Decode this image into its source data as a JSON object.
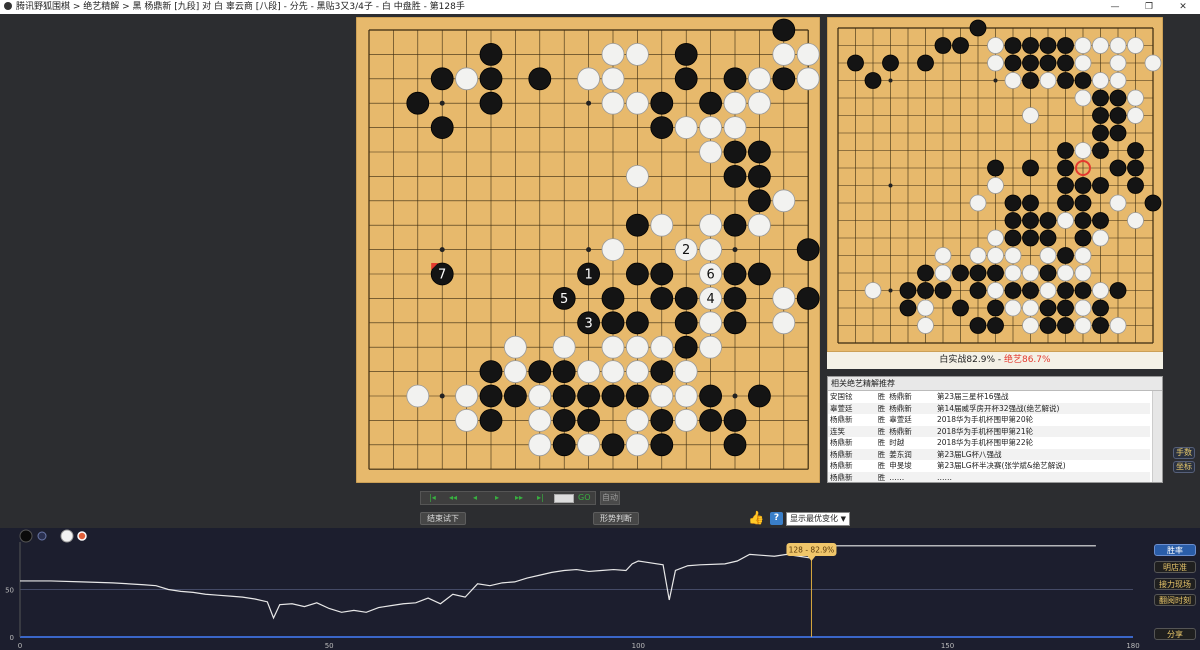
{
  "window": {
    "title": "腾讯野狐围棋 > 绝艺精解 > 黑 杨鼎新 [九段] 对 白 辜云商 [八段] - 分先 - 黑贴3又3/4子 - 白 中盘胜 - 第128手",
    "controls": [
      "—",
      "❐",
      "✕"
    ]
  },
  "board": {
    "size": 19,
    "star_points": [
      [
        3,
        3
      ],
      [
        3,
        9
      ],
      [
        3,
        15
      ],
      [
        9,
        3
      ],
      [
        9,
        9
      ],
      [
        9,
        15
      ],
      [
        15,
        3
      ],
      [
        15,
        9
      ],
      [
        15,
        15
      ]
    ],
    "black": [
      [
        17,
        0
      ],
      [
        5,
        1
      ],
      [
        13,
        1
      ],
      [
        3,
        2
      ],
      [
        5,
        2
      ],
      [
        7,
        2
      ],
      [
        13,
        2
      ],
      [
        15,
        2
      ],
      [
        17,
        2
      ],
      [
        2,
        3
      ],
      [
        5,
        3
      ],
      [
        12,
        3
      ],
      [
        14,
        3
      ],
      [
        3,
        4
      ],
      [
        12,
        4
      ],
      [
        15,
        5
      ],
      [
        16,
        5
      ],
      [
        15,
        6
      ],
      [
        16,
        6
      ],
      [
        16,
        7
      ],
      [
        11,
        8
      ],
      [
        15,
        8
      ],
      [
        18,
        9
      ],
      [
        9,
        10
      ],
      [
        11,
        10
      ],
      [
        12,
        10
      ],
      [
        15,
        10
      ],
      [
        16,
        10
      ],
      [
        10,
        11
      ],
      [
        12,
        11
      ],
      [
        13,
        11
      ],
      [
        15,
        11
      ],
      [
        18,
        11
      ],
      [
        10,
        12
      ],
      [
        11,
        12
      ],
      [
        13,
        12
      ],
      [
        15,
        12
      ],
      [
        13,
        13
      ],
      [
        5,
        14
      ],
      [
        7,
        14
      ],
      [
        8,
        14
      ],
      [
        12,
        14
      ],
      [
        5,
        15
      ],
      [
        6,
        15
      ],
      [
        8,
        15
      ],
      [
        9,
        15
      ],
      [
        10,
        15
      ],
      [
        11,
        15
      ],
      [
        14,
        15
      ],
      [
        16,
        15
      ],
      [
        5,
        16
      ],
      [
        8,
        16
      ],
      [
        9,
        16
      ],
      [
        12,
        16
      ],
      [
        14,
        16
      ],
      [
        15,
        16
      ],
      [
        8,
        17
      ],
      [
        10,
        17
      ],
      [
        12,
        17
      ],
      [
        15,
        17
      ]
    ],
    "white": [
      [
        10,
        1
      ],
      [
        11,
        1
      ],
      [
        17,
        1
      ],
      [
        18,
        1
      ],
      [
        4,
        2
      ],
      [
        9,
        2
      ],
      [
        10,
        2
      ],
      [
        16,
        2
      ],
      [
        18,
        2
      ],
      [
        11,
        3
      ],
      [
        12,
        3
      ],
      [
        10,
        3
      ],
      [
        15,
        3
      ],
      [
        16,
        3
      ],
      [
        13,
        4
      ],
      [
        14,
        4
      ],
      [
        15,
        4
      ],
      [
        14,
        5
      ],
      [
        16,
        5
      ],
      [
        11,
        6
      ],
      [
        16,
        6
      ],
      [
        17,
        7
      ],
      [
        12,
        8
      ],
      [
        14,
        8
      ],
      [
        16,
        8
      ],
      [
        10,
        9
      ],
      [
        14,
        9
      ],
      [
        11,
        10
      ],
      [
        17,
        11
      ],
      [
        12,
        11
      ],
      [
        11,
        12
      ],
      [
        14,
        12
      ],
      [
        17,
        12
      ],
      [
        6,
        13
      ],
      [
        8,
        13
      ],
      [
        10,
        13
      ],
      [
        11,
        13
      ],
      [
        12,
        13
      ],
      [
        13,
        13
      ],
      [
        14,
        13
      ],
      [
        6,
        14
      ],
      [
        9,
        14
      ],
      [
        10,
        14
      ],
      [
        11,
        14
      ],
      [
        13,
        14
      ],
      [
        2,
        15
      ],
      [
        4,
        15
      ],
      [
        7,
        15
      ],
      [
        12,
        15
      ],
      [
        13,
        15
      ],
      [
        4,
        16
      ],
      [
        7,
        16
      ],
      [
        9,
        16
      ],
      [
        11,
        16
      ],
      [
        13,
        16
      ],
      [
        7,
        17
      ],
      [
        9,
        17
      ],
      [
        11,
        17
      ]
    ],
    "numbered": [
      {
        "x": 9,
        "y": 10,
        "color": "black",
        "label": "1"
      },
      {
        "x": 13,
        "y": 9,
        "color": "white",
        "label": "2"
      },
      {
        "x": 9,
        "y": 12,
        "color": "black",
        "label": "3"
      },
      {
        "x": 14,
        "y": 11,
        "color": "white",
        "label": "4"
      },
      {
        "x": 8,
        "y": 11,
        "color": "black",
        "label": "5"
      },
      {
        "x": 14,
        "y": 10,
        "color": "white",
        "label": "6"
      },
      {
        "x": 3,
        "y": 10,
        "color": "black",
        "label": "7"
      }
    ],
    "last_move": [
      3,
      10
    ]
  },
  "mini_board": {
    "black": [
      [
        8,
        0
      ],
      [
        10,
        1
      ],
      [
        11,
        1
      ],
      [
        12,
        1
      ],
      [
        13,
        1
      ],
      [
        6,
        1
      ],
      [
        7,
        1
      ],
      [
        10,
        2
      ],
      [
        11,
        2
      ],
      [
        12,
        2
      ],
      [
        13,
        2
      ],
      [
        1,
        2
      ],
      [
        3,
        2
      ],
      [
        5,
        2
      ],
      [
        13,
        3
      ],
      [
        14,
        3
      ],
      [
        2,
        3
      ],
      [
        11,
        3
      ],
      [
        15,
        4
      ],
      [
        16,
        4
      ],
      [
        15,
        5
      ],
      [
        16,
        5
      ],
      [
        15,
        6
      ],
      [
        16,
        6
      ],
      [
        15,
        7
      ],
      [
        17,
        7
      ],
      [
        13,
        7
      ],
      [
        11,
        8
      ],
      [
        13,
        8
      ],
      [
        16,
        8
      ],
      [
        17,
        8
      ],
      [
        9,
        8
      ],
      [
        13,
        9
      ],
      [
        14,
        9
      ],
      [
        15,
        9
      ],
      [
        17,
        9
      ],
      [
        10,
        10
      ],
      [
        11,
        10
      ],
      [
        13,
        10
      ],
      [
        14,
        10
      ],
      [
        18,
        10
      ],
      [
        10,
        11
      ],
      [
        11,
        11
      ],
      [
        12,
        11
      ],
      [
        14,
        11
      ],
      [
        15,
        11
      ],
      [
        10,
        12
      ],
      [
        11,
        12
      ],
      [
        12,
        12
      ],
      [
        14,
        12
      ],
      [
        13,
        13
      ],
      [
        5,
        14
      ],
      [
        7,
        14
      ],
      [
        8,
        14
      ],
      [
        9,
        14
      ],
      [
        12,
        14
      ],
      [
        4,
        15
      ],
      [
        5,
        15
      ],
      [
        6,
        15
      ],
      [
        8,
        15
      ],
      [
        10,
        15
      ],
      [
        11,
        15
      ],
      [
        13,
        15
      ],
      [
        14,
        15
      ],
      [
        16,
        15
      ],
      [
        4,
        16
      ],
      [
        7,
        16
      ],
      [
        9,
        16
      ],
      [
        12,
        16
      ],
      [
        13,
        16
      ],
      [
        15,
        16
      ],
      [
        8,
        17
      ],
      [
        9,
        17
      ],
      [
        12,
        17
      ],
      [
        13,
        17
      ],
      [
        15,
        17
      ]
    ],
    "white": [
      [
        10,
        1
      ],
      [
        11,
        1
      ],
      [
        12,
        1
      ],
      [
        14,
        1
      ],
      [
        15,
        1
      ],
      [
        16,
        1
      ],
      [
        17,
        1
      ],
      [
        9,
        1
      ],
      [
        9,
        2
      ],
      [
        14,
        2
      ],
      [
        16,
        2
      ],
      [
        18,
        2
      ],
      [
        12,
        3
      ],
      [
        15,
        3
      ],
      [
        16,
        3
      ],
      [
        10,
        3
      ],
      [
        14,
        4
      ],
      [
        17,
        4
      ],
      [
        11,
        5
      ],
      [
        17,
        5
      ],
      [
        13,
        7
      ],
      [
        14,
        7
      ],
      [
        17,
        8
      ],
      [
        9,
        9
      ],
      [
        14,
        9
      ],
      [
        16,
        10
      ],
      [
        17,
        11
      ],
      [
        12,
        11
      ],
      [
        8,
        10
      ],
      [
        13,
        11
      ],
      [
        9,
        12
      ],
      [
        12,
        12
      ],
      [
        15,
        12
      ],
      [
        6,
        13
      ],
      [
        8,
        13
      ],
      [
        9,
        13
      ],
      [
        10,
        13
      ],
      [
        12,
        13
      ],
      [
        13,
        13
      ],
      [
        14,
        13
      ],
      [
        6,
        14
      ],
      [
        10,
        14
      ],
      [
        11,
        14
      ],
      [
        12,
        14
      ],
      [
        13,
        14
      ],
      [
        14,
        14
      ],
      [
        2,
        15
      ],
      [
        6,
        15
      ],
      [
        9,
        15
      ],
      [
        12,
        15
      ],
      [
        15,
        15
      ],
      [
        5,
        16
      ],
      [
        10,
        16
      ],
      [
        11,
        16
      ],
      [
        14,
        16
      ],
      [
        5,
        17
      ],
      [
        11,
        17
      ],
      [
        14,
        17
      ],
      [
        16,
        17
      ]
    ],
    "marked": [
      14,
      8
    ]
  },
  "winrate": {
    "prefix": "白实战82.9% - ",
    "ai": "绝艺86.7%"
  },
  "refs": {
    "header": "相关绝艺精解推荐",
    "rows": [
      [
        "安国铉",
        "胜",
        "杨鼎新",
        "第23届三星杯16强战"
      ],
      [
        "辜萱廷",
        "胜",
        "杨鼎新",
        "第14届威孚房开杯32强战(绝艺解说)"
      ],
      [
        "杨鼎新",
        "胜",
        "辜萱廷",
        "2018华为手机杯围甲第20轮"
      ],
      [
        "连笑",
        "胜",
        "杨鼎新",
        "2018华为手机杯围甲第21轮"
      ],
      [
        "杨鼎新",
        "胜",
        "时越",
        "2018华为手机杯围甲第22轮"
      ],
      [
        "杨鼎新",
        "胜",
        "姜东润",
        "第23届LG杯八强战"
      ],
      [
        "杨鼎新",
        "胜",
        "申旻埈",
        "第23届LG杯半决赛(张学斌&绝艺解说)"
      ],
      [
        "杨鼎新",
        "胜",
        "……",
        "……"
      ]
    ]
  },
  "side_buttons": {
    "moves": "手数",
    "coords": "坐标"
  },
  "controls": {
    "nav": [
      "|◂",
      "◂◂",
      "◂",
      "▸",
      "▸▸",
      "▸|",
      "GO"
    ],
    "auto": "自动",
    "end_trial": "结束试下",
    "judge": "形势判断",
    "help": "?",
    "select": "显示最优变化"
  },
  "graph": {
    "tooltip": "128 - 82.9%",
    "x_ticks": [
      "0",
      "50",
      "100",
      "150",
      "180"
    ],
    "y_ticks": [
      "100",
      "50",
      "0"
    ],
    "x_max": 180,
    "current_move": 128,
    "series": [
      [
        0,
        59
      ],
      [
        5,
        59
      ],
      [
        10,
        58
      ],
      [
        15,
        57
      ],
      [
        20,
        55
      ],
      [
        22,
        54
      ],
      [
        24,
        50
      ],
      [
        26,
        48
      ],
      [
        28,
        47
      ],
      [
        30,
        45
      ],
      [
        32,
        44
      ],
      [
        34,
        43
      ],
      [
        36,
        42
      ],
      [
        38,
        40
      ],
      [
        40,
        37
      ],
      [
        41,
        20
      ],
      [
        42,
        34
      ],
      [
        44,
        35
      ],
      [
        46,
        32
      ],
      [
        48,
        36
      ],
      [
        50,
        30
      ],
      [
        52,
        26
      ],
      [
        54,
        28
      ],
      [
        56,
        26
      ],
      [
        58,
        31
      ],
      [
        60,
        33
      ],
      [
        62,
        35
      ],
      [
        64,
        36
      ],
      [
        66,
        41
      ],
      [
        68,
        35
      ],
      [
        70,
        45
      ],
      [
        72,
        42
      ],
      [
        74,
        56
      ],
      [
        76,
        54
      ],
      [
        78,
        57
      ],
      [
        80,
        58
      ],
      [
        82,
        62
      ],
      [
        84,
        65
      ],
      [
        86,
        68
      ],
      [
        88,
        70
      ],
      [
        90,
        71
      ],
      [
        92,
        69
      ],
      [
        94,
        70
      ],
      [
        96,
        71
      ],
      [
        98,
        70
      ],
      [
        99,
        77
      ],
      [
        100,
        80
      ],
      [
        101,
        79
      ],
      [
        104,
        76
      ],
      [
        105,
        39
      ],
      [
        106,
        70
      ],
      [
        108,
        75
      ],
      [
        110,
        76
      ],
      [
        114,
        77
      ],
      [
        116,
        80
      ],
      [
        118,
        87
      ],
      [
        120,
        86
      ],
      [
        122,
        85
      ],
      [
        124,
        87
      ],
      [
        126,
        85
      ],
      [
        128,
        83
      ],
      [
        129,
        89
      ],
      [
        130,
        96
      ],
      [
        135,
        96
      ],
      [
        140,
        96
      ],
      [
        150,
        96
      ],
      [
        160,
        96
      ],
      [
        170,
        96
      ],
      [
        174,
        96
      ]
    ]
  },
  "right_buttons": {
    "stats": "胜率",
    "hand": "明店准",
    "live": "接力现场",
    "time": "翻阅时刻",
    "share": "分享"
  },
  "colors": {
    "board": "#e7b96c",
    "bg": "#2c2d30",
    "graph_bg": "#1c1e2e",
    "accent_red": "#e43a2f",
    "tooltip": "#f0c66a"
  }
}
